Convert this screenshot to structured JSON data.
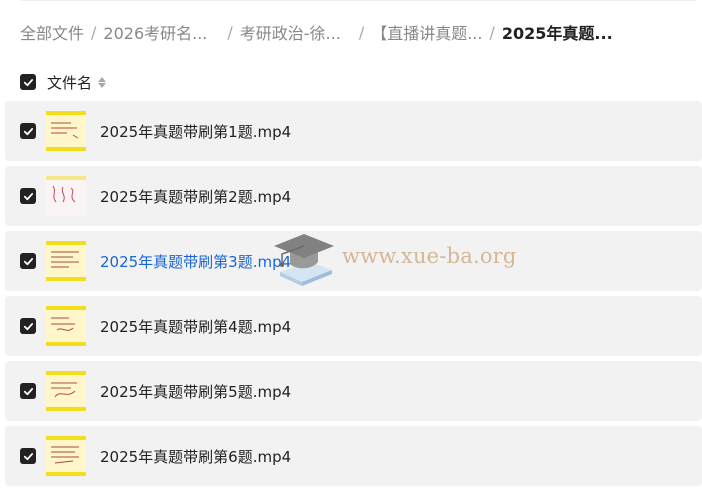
{
  "breadcrumb": [
    {
      "label": "全部文件"
    },
    {
      "label": "2026考研名..."
    },
    {
      "label": "考研政治-徐..."
    },
    {
      "label": "【直播讲真题..."
    },
    {
      "label": "2025年真题..."
    }
  ],
  "list_header": {
    "column_title": "文件名",
    "all_checked": true
  },
  "files": [
    {
      "name": "2025年真题带刷第1题.mp4",
      "checked": true
    },
    {
      "name": "2025年真题带刷第2题.mp4",
      "checked": true
    },
    {
      "name": "2025年真题带刷第3题.mp4",
      "checked": true,
      "hovered": true
    },
    {
      "name": "2025年真题带刷第4题.mp4",
      "checked": true
    },
    {
      "name": "2025年真题带刷第5题.mp4",
      "checked": true
    },
    {
      "name": "2025年真题带刷第6题.mp4",
      "checked": true
    }
  ],
  "watermark": {
    "text": "www.xue-ba.org"
  },
  "colors": {
    "row_bg": "#f2f2f2",
    "hover_link": "#1a66d6",
    "checkbox": "#222222",
    "thumb_band": "#f3dd1c"
  }
}
